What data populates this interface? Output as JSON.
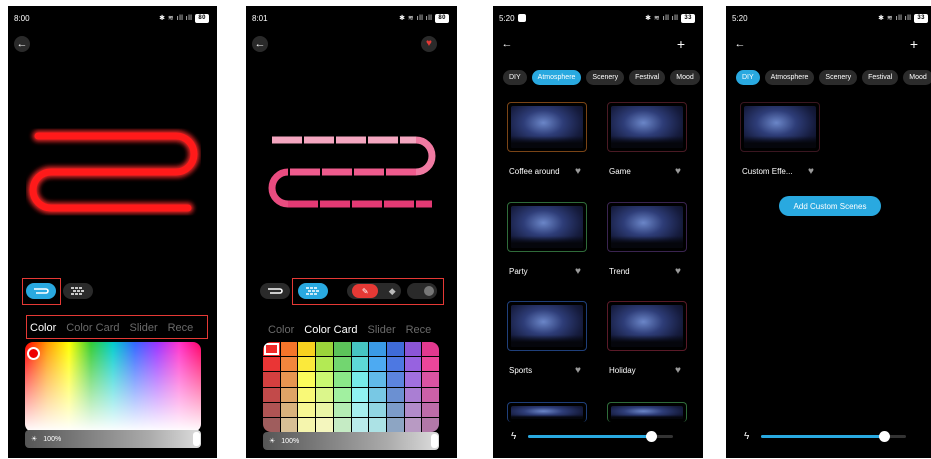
{
  "colors": {
    "accent": "#29a9e0",
    "highlight_box": "#e53935",
    "strip_red": "#ff2020",
    "strip_pink": "#ef5b8f"
  },
  "screen1": {
    "status_time": "8:00",
    "battery": "80",
    "tabs": [
      "Color",
      "Color Card",
      "Slider",
      "Rece"
    ],
    "active_tab": "Color",
    "brightness_label": "100%",
    "brightness_level": 1.0
  },
  "screen2": {
    "status_time": "8:01",
    "battery": "80",
    "tabs": [
      "Color",
      "Color Card",
      "Slider",
      "Rece"
    ],
    "active_tab": "Color Card",
    "brightness_label": "100%",
    "brightness_level": 1.0
  },
  "screen3": {
    "status_time": "5:20",
    "battery": "33",
    "chips": [
      "DIY",
      "Atmosphere",
      "Scenery",
      "Festival",
      "Mood"
    ],
    "active_chip": "Atmosphere",
    "scenes": [
      {
        "label": "Coffee around",
        "border": "#6b3b12"
      },
      {
        "label": "Game",
        "border": "#4a1a24"
      },
      {
        "label": "Party",
        "border": "#2f6b3a"
      },
      {
        "label": "Trend",
        "border": "#3a2450"
      },
      {
        "label": "Sports",
        "border": "#1f3f7a"
      },
      {
        "label": "Holiday",
        "border": "#5a1a28"
      }
    ],
    "speed_level": 0.85
  },
  "screen4": {
    "status_time": "5:20",
    "battery": "33",
    "chips": [
      "DIY",
      "Atmosphere",
      "Scenery",
      "Festival",
      "Mood"
    ],
    "active_chip": "DIY",
    "scene_label": "Custom Effe...",
    "add_button": "Add Custom Scenes",
    "speed_level": 0.85
  }
}
